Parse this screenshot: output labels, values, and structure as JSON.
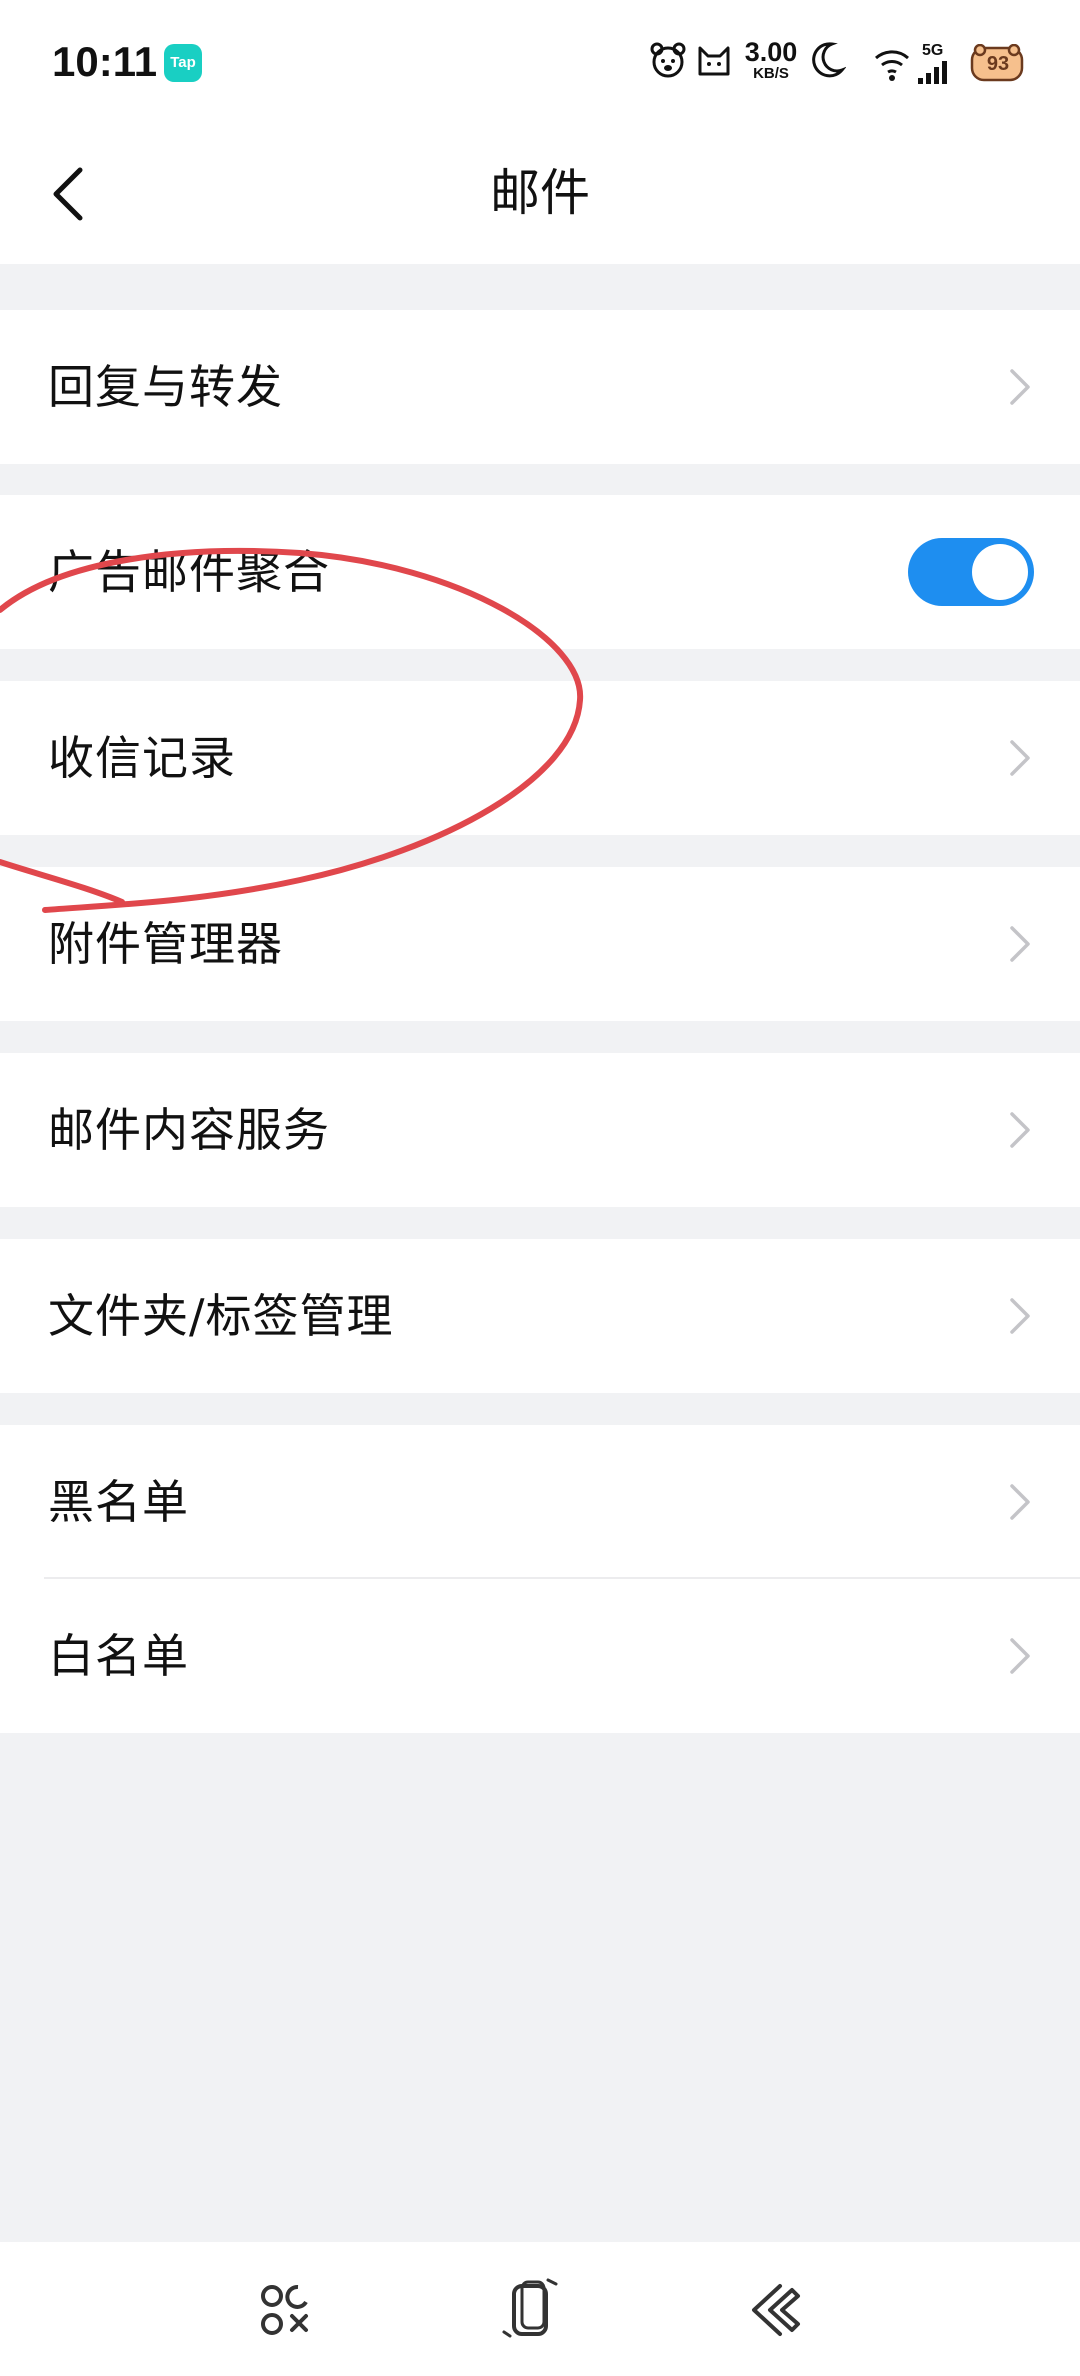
{
  "status_bar": {
    "time": "10:11",
    "app_badge": "Tap",
    "net_speed_value": "3.00",
    "net_speed_unit": "KB/S",
    "network": "5G",
    "battery_level": "93"
  },
  "nav": {
    "title": "邮件",
    "back_icon": "chevron-left-icon"
  },
  "groups": [
    {
      "items": [
        {
          "label": "回复与转发",
          "control": "chevron"
        }
      ]
    },
    {
      "items": [
        {
          "label": "广告邮件聚合",
          "control": "toggle",
          "toggle_on": true
        }
      ]
    },
    {
      "items": [
        {
          "label": "收信记录",
          "control": "chevron"
        }
      ]
    },
    {
      "items": [
        {
          "label": "附件管理器",
          "control": "chevron"
        }
      ]
    },
    {
      "items": [
        {
          "label": "邮件内容服务",
          "control": "chevron"
        }
      ]
    },
    {
      "items": [
        {
          "label": "文件夹/标签管理",
          "control": "chevron"
        }
      ]
    },
    {
      "items": [
        {
          "label": "黑名单",
          "control": "chevron"
        },
        {
          "label": "白名单",
          "control": "chevron"
        }
      ]
    }
  ],
  "colors": {
    "accent": "#1e8ef0",
    "background": "#f1f2f4",
    "annotation": "#e0474c",
    "chevron": "#c4c4c8"
  },
  "system_nav": {
    "menu_icon": "menu-icon",
    "home_icon": "home-icon",
    "back_icon": "back-icon"
  }
}
